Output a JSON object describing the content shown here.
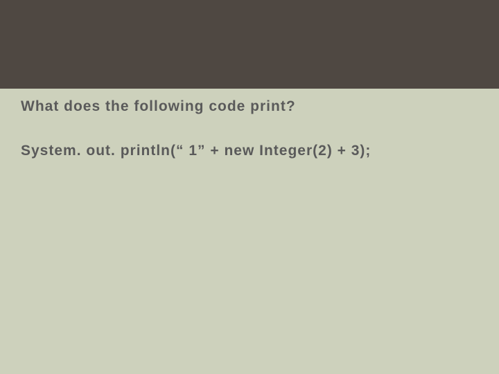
{
  "slide": {
    "question": "What does the following code print?",
    "code": "System. out. println(“ 1” + new Integer(2) + 3);"
  }
}
